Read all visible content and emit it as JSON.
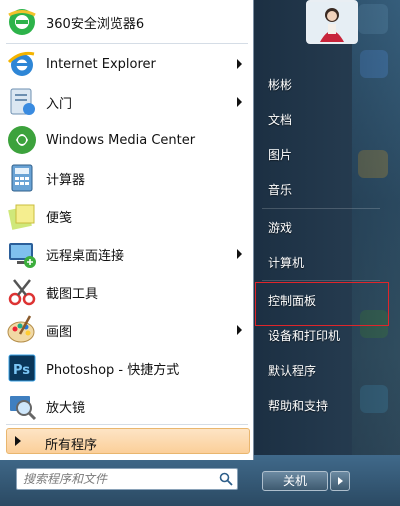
{
  "programs": [
    {
      "label": "360安全浏览器6",
      "icon": "360-browser-icon",
      "has_arrow": false
    },
    {
      "label": "Internet Explorer",
      "icon": "internet-explorer-icon",
      "has_arrow": true
    },
    {
      "label": "入门",
      "icon": "getting-started-icon",
      "has_arrow": true
    },
    {
      "label": "Windows Media Center",
      "icon": "media-center-icon",
      "has_arrow": false
    },
    {
      "label": "计算器",
      "icon": "calculator-icon",
      "has_arrow": false
    },
    {
      "label": "便笺",
      "icon": "sticky-notes-icon",
      "has_arrow": false
    },
    {
      "label": "远程桌面连接",
      "icon": "remote-desktop-icon",
      "has_arrow": true
    },
    {
      "label": "截图工具",
      "icon": "snipping-tool-icon",
      "has_arrow": false
    },
    {
      "label": "画图",
      "icon": "paint-icon",
      "has_arrow": true
    },
    {
      "label": "Photoshop - 快捷方式",
      "icon": "photoshop-icon",
      "has_arrow": false
    },
    {
      "label": "放大镜",
      "icon": "magnifier-icon",
      "has_arrow": false
    }
  ],
  "all_programs": "所有程序",
  "search": {
    "placeholder": "搜索程序和文件"
  },
  "right_menu": {
    "user": "彬彬",
    "documents": "文档",
    "pictures": "图片",
    "music": "音乐",
    "games": "游戏",
    "computer": "计算机",
    "control_panel": "控制面板",
    "devices_printers": "设备和打印机",
    "default_programs": "默认程序",
    "help_support": "帮助和支持"
  },
  "shutdown": {
    "label": "关机"
  },
  "colors": {
    "highlight_border": "#e0252a",
    "all_programs_bg": "#fbcf99"
  }
}
